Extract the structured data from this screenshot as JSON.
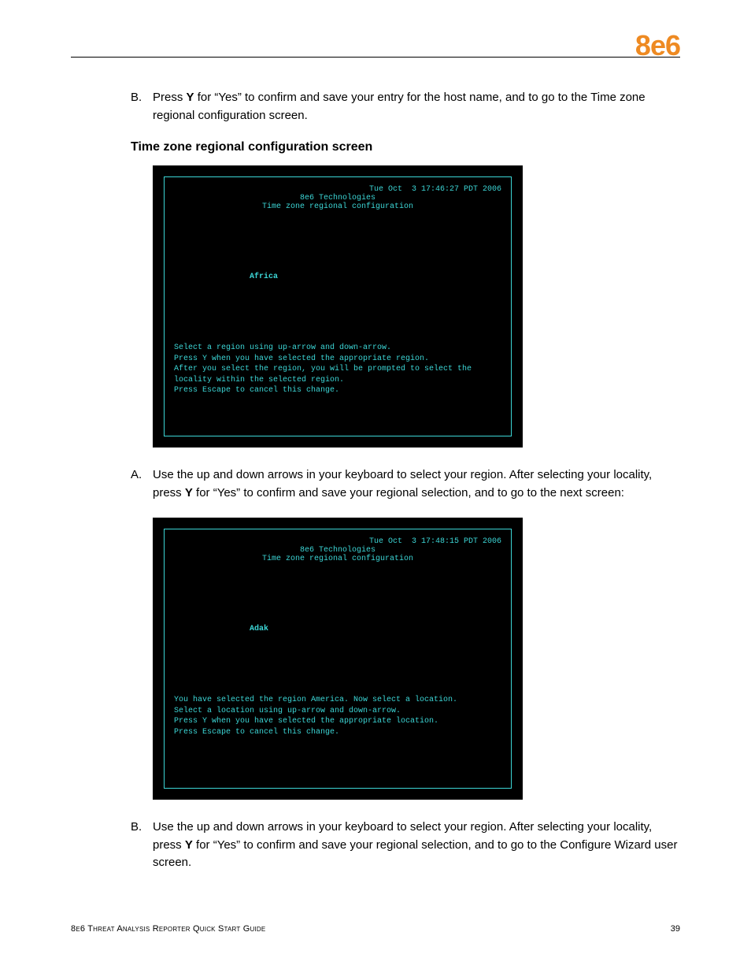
{
  "header": {
    "logo": "8e6"
  },
  "intro_item": {
    "marker": "B.",
    "text_before": "Press ",
    "key": "Y",
    "text_after": " for “Yes” to confirm and save your entry for the host name, and to go to the Time zone regional configuration screen."
  },
  "section_heading": "Time zone regional configuration screen",
  "terminal1": {
    "date": "Tue Oct  3 17:46:27 PDT 2006",
    "company": "8e6 Technologies",
    "title": "Time zone regional configuration",
    "selection": "Africa",
    "help": "Select a region using up-arrow and down-arrow.\nPress Y when you have selected the appropriate region.\nAfter you select the region, you will be prompted to select the\nlocality within the selected region.\nPress Escape to cancel this change."
  },
  "step_a": {
    "marker": "A.",
    "text_before": "Use the up and down arrows in your keyboard to select your region. After selecting your locality, press ",
    "key": "Y",
    "text_after": " for “Yes” to confirm and save your regional selection, and to go to the next screen:"
  },
  "terminal2": {
    "date": "Tue Oct  3 17:48:15 PDT 2006",
    "company": "8e6 Technologies",
    "title": "Time zone regional configuration",
    "selection": "Adak",
    "help": "You have selected the region America. Now select a location.\nSelect a location using up-arrow and down-arrow.\nPress Y when you have selected the appropriate location.\nPress Escape to cancel this change."
  },
  "step_b": {
    "marker": "B.",
    "text_before": "Use the up and down arrows in your keyboard to select your region. After selecting your locality, press ",
    "key": "Y",
    "text_after": " for “Yes” to confirm and save your regional selection, and to go to the Configure Wizard user screen."
  },
  "footer": {
    "title": "8e6 Threat Analysis Reporter Quick Start Guide",
    "page": "39"
  }
}
